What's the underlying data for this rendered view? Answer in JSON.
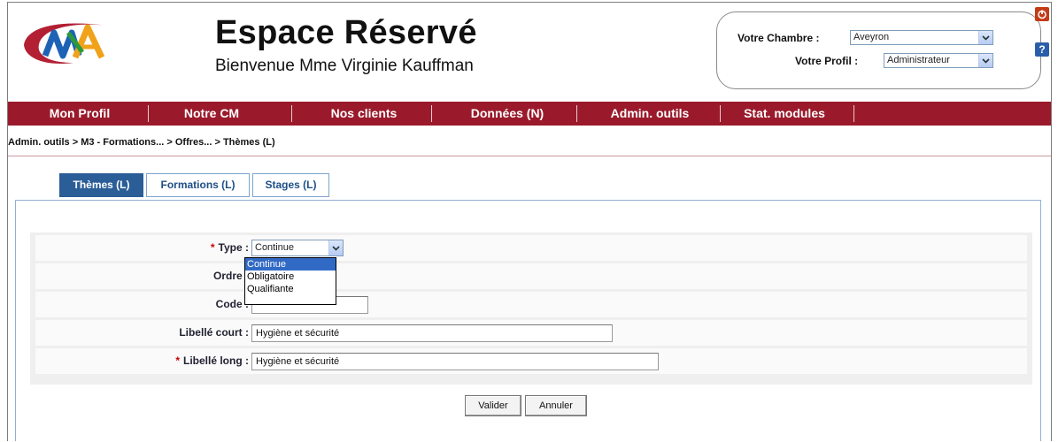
{
  "header": {
    "title": "Espace Réservé",
    "welcome": "Bienvenue  Mme Virginie Kauffman",
    "chambre_label": "Votre Chambre :",
    "chambre_value": "Aveyron",
    "profil_label": "Votre Profil :",
    "profil_value": "Administrateur",
    "help_icon_text": "?"
  },
  "menu": {
    "items": [
      "Mon Profil",
      "Notre CM",
      "Nos clients",
      "Données (N)",
      "Admin. outils",
      "Stat. modules"
    ]
  },
  "breadcrumb": "Admin. outils > M3 - Formations... > Offres... > Thèmes (L)",
  "tabs": [
    "Thèmes (L)",
    "Formations (L)",
    "Stages (L)"
  ],
  "form": {
    "type_label": "Type :",
    "type_value": "Continue",
    "type_options": [
      "Continue",
      "Obligatoire",
      "Qualifiante"
    ],
    "ordre_label": "Ordre :",
    "code_label": "Code :",
    "libelle_court_label": "Libellé court :",
    "libelle_court_value": "Hygiène et sécurité",
    "libelle_long_label": "Libellé long :",
    "libelle_long_value": "Hygiène et sécurité",
    "required_mark": "*"
  },
  "buttons": {
    "valider": "Valider",
    "annuler": "Annuler"
  },
  "colors": {
    "menu_bg": "#9a1a2b",
    "tab_active": "#2b5e97",
    "tab_border": "#7ea3cc",
    "required": "#cc0000",
    "dropdown_highlight": "#316ac5"
  }
}
